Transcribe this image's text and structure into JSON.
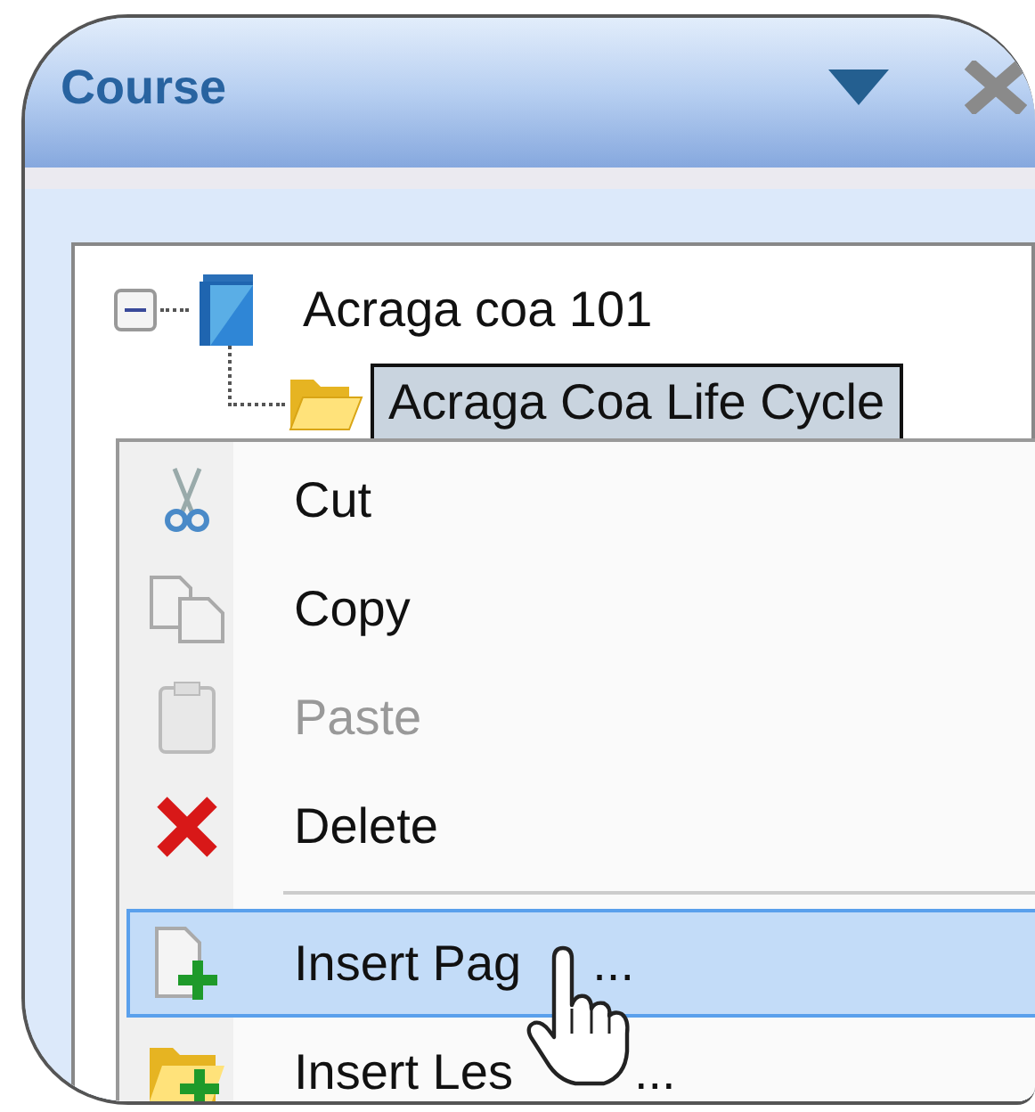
{
  "panel": {
    "title": "Course"
  },
  "tree": {
    "items": [
      {
        "label": "Acraga coa 101",
        "expanded": true,
        "selected": false,
        "children": [
          {
            "label": "Acraga Coa Life Cycle",
            "selected": true
          }
        ]
      }
    ]
  },
  "context_menu": {
    "items": [
      {
        "kind": "command",
        "label": "Cut",
        "disabled": false,
        "selected": false
      },
      {
        "kind": "command",
        "label": "Copy",
        "disabled": false,
        "selected": false
      },
      {
        "kind": "command",
        "label": "Paste",
        "disabled": true,
        "selected": false
      },
      {
        "kind": "command",
        "label": "Delete",
        "disabled": false,
        "selected": false
      },
      {
        "kind": "separator"
      },
      {
        "kind": "command",
        "label": "Insert Pag",
        "label_end": "...",
        "disabled": false,
        "selected": true
      },
      {
        "kind": "command",
        "label": "Insert Les",
        "label_end": "...",
        "disabled": false,
        "selected": false
      }
    ]
  }
}
